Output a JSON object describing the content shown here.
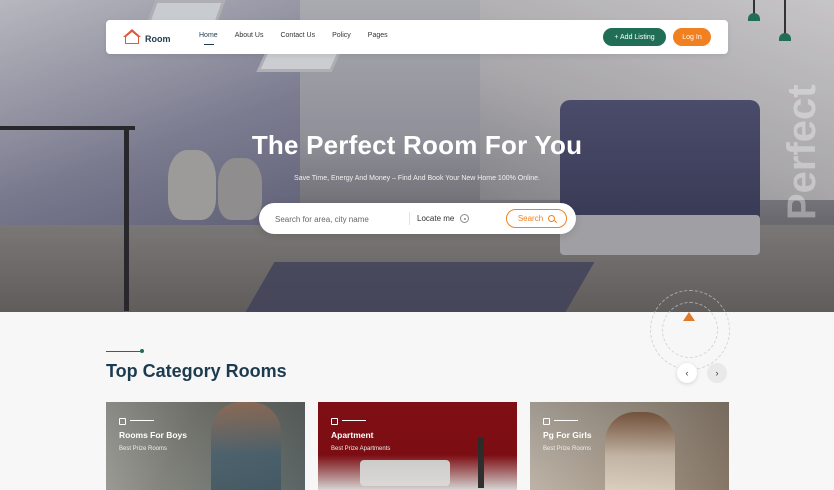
{
  "navbar": {
    "logo_text": "Room",
    "nav_items": [
      "Home",
      "About Us",
      "Contact Us",
      "Policy",
      "Pages"
    ],
    "add_listing_label": "+ Add Listing",
    "login_label": "Log In"
  },
  "hero": {
    "title": "The Perfect Room For You",
    "subtitle": "Save Time, Energy And Money – Find And Book Your New Home 100% Online.",
    "background_word": "Perfect"
  },
  "search": {
    "placeholder": "Search for area, city name",
    "locate_label": "Locate me",
    "button_label": "Search"
  },
  "section": {
    "title": "Top Category Rooms"
  },
  "cards": [
    {
      "title": "Rooms For Boys",
      "subtitle": "Best Prize Rooms"
    },
    {
      "title": "Apartment",
      "subtitle": "Best Prize Apartments"
    },
    {
      "title": "Pg For Girls",
      "subtitle": "Best Prize Rooms"
    }
  ],
  "colors": {
    "primary_green": "#1f6e55",
    "accent_orange": "#f08020",
    "heading_navy": "#1d3b4e"
  }
}
